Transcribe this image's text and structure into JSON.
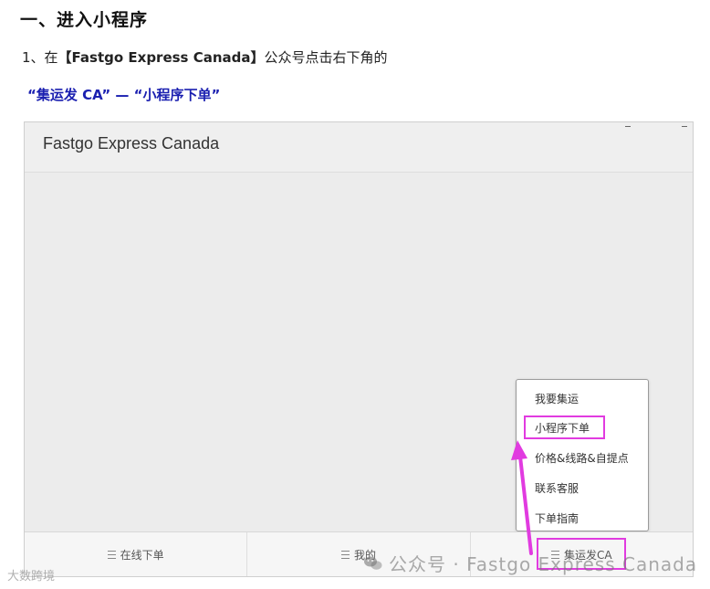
{
  "heading": "一、进入小程序",
  "step": {
    "prefix": "1、在",
    "account": "【Fastgo Express Canada】",
    "suffix": "公众号点击右下角的"
  },
  "path": "“集运发 CA” — “小程序下单”",
  "screenshot": {
    "title": "Fastgo Express Canada",
    "popup_items": [
      "我要集运",
      "小程序下单",
      "价格&线路&自提点",
      "联系客服",
      "下单指南"
    ],
    "menu": [
      "在线下单",
      "我的",
      "集运发CA"
    ]
  },
  "watermarks": {
    "left": "大数跨境",
    "right": "公众号 · Fastgo Express Canada"
  },
  "colors": {
    "highlight": "#e13be0",
    "path_text": "#1a1fb0"
  }
}
